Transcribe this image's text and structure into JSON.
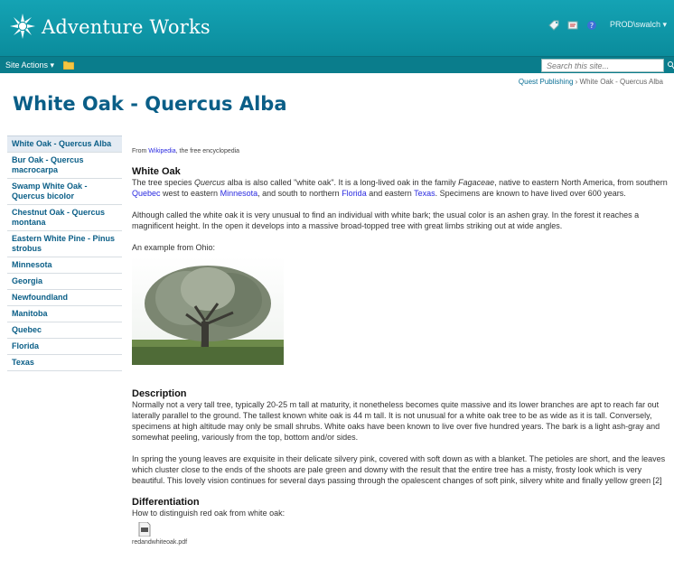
{
  "header": {
    "brand": "Adventure Works",
    "user": "PROD\\swalch ▾",
    "icons": [
      "tag-icon",
      "notes-icon",
      "help-icon"
    ]
  },
  "actionbar": {
    "site_actions": "Site Actions ▾",
    "search_placeholder": "Search this site..."
  },
  "breadcrumb": {
    "root": "Quest Publishing",
    "separator": " › ",
    "current": "White Oak - Quercus Alba"
  },
  "page_title": "White Oak - Quercus Alba",
  "leftnav": {
    "items": [
      "White Oak - Quercus Alba",
      "Bur Oak - Quercus macrocarpa",
      "Swamp White Oak - Quercus bicolor",
      "Chestnut Oak - Quercus montana",
      "Eastern White Pine - Pinus strobus",
      "Minnesota",
      "Georgia",
      "Newfoundland",
      "Manitoba",
      "Quebec",
      "Florida",
      "Texas"
    ]
  },
  "content": {
    "source_prefix": "From ",
    "source_link": "Wikipedia",
    "source_suffix": ", the free encyclopedia",
    "white_oak_heading": "White Oak",
    "p1": {
      "t1": "The tree species ",
      "i1": "Quercus",
      "t2": " alba is also called \"white oak\". It is a long-lived oak in the family ",
      "i2": "Fagaceae",
      "t3": ", native to eastern North America, from southern ",
      "link_quebec": "Quebec",
      "t4": " west to eastern ",
      "link_minnesota": "Minnesota",
      "t5": ", and south to northern ",
      "link_florida": "Florida",
      "t6": " and eastern ",
      "link_texas": "Texas",
      "t7": ". Specimens are known to have lived over 600 years."
    },
    "p2": "Although called the white oak it is very unusual to find an individual with white bark; the usual color is an ashen gray. In the forest it reaches a magnificent height. In the open it develops into a massive broad-topped tree with great limbs striking out at wide angles.",
    "example_label": "An example from Ohio:",
    "description_heading": "Description",
    "p3": "Normally not a very tall tree, typically 20-25 m tall at maturity, it nonetheless becomes quite massive and its lower branches are apt to reach far out laterally parallel to the ground. The tallest known white oak is 44 m tall. It is not unusual for a white oak tree to be as wide as it is tall. Conversely, specimens at high altitude may only be small shrubs. White oaks have been known to live over five hundred years. The bark is a light ash-gray and somewhat peeling, variously from the top, bottom and/or sides.",
    "p4": "In spring the young leaves are exquisite in their delicate silvery pink, covered with soft down as with a blanket. The petioles are short, and the leaves which cluster close to the ends of the shoots are pale green and downy with the result that the entire tree has a misty, frosty look which is very beautiful. This lovely vision continues for several days passing through the opalescent changes of soft pink, silvery white and finally yellow green [2]",
    "differentiation_heading": "Differentiation",
    "p5": "How to distinguish red oak from white oak:",
    "attachment_name": "redandwhiteoak.pdf"
  },
  "colors": {
    "banner": "#0b8c9c",
    "title": "#0a5e87",
    "link": "#2a2ae0"
  }
}
